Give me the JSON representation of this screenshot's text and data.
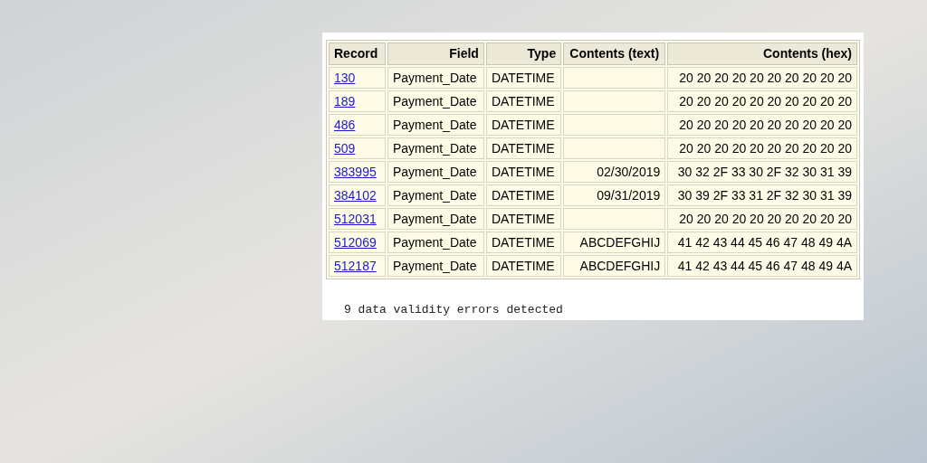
{
  "table": {
    "columns": [
      "Record",
      "Field",
      "Type",
      "Contents (text)",
      "Contents (hex)"
    ],
    "rows": [
      {
        "record": "130",
        "field": "Payment_Date",
        "type": "DATETIME",
        "contents_text": "",
        "contents_hex": "20 20 20 20 20 20 20 20 20 20"
      },
      {
        "record": "189",
        "field": "Payment_Date",
        "type": "DATETIME",
        "contents_text": "",
        "contents_hex": "20 20 20 20 20 20 20 20 20 20"
      },
      {
        "record": "486",
        "field": "Payment_Date",
        "type": "DATETIME",
        "contents_text": "",
        "contents_hex": "20 20 20 20 20 20 20 20 20 20"
      },
      {
        "record": "509",
        "field": "Payment_Date",
        "type": "DATETIME",
        "contents_text": "",
        "contents_hex": "20 20 20 20 20 20 20 20 20 20"
      },
      {
        "record": "383995",
        "field": "Payment_Date",
        "type": "DATETIME",
        "contents_text": "02/30/2019",
        "contents_hex": "30 32 2F 33 30 2F 32 30 31 39"
      },
      {
        "record": "384102",
        "field": "Payment_Date",
        "type": "DATETIME",
        "contents_text": "09/31/2019",
        "contents_hex": "30 39 2F 33 31 2F 32 30 31 39"
      },
      {
        "record": "512031",
        "field": "Payment_Date",
        "type": "DATETIME",
        "contents_text": "",
        "contents_hex": "20 20 20 20 20 20 20 20 20 20"
      },
      {
        "record": "512069",
        "field": "Payment_Date",
        "type": "DATETIME",
        "contents_text": "ABCDEFGHIJ",
        "contents_hex": "41 42 43 44 45 46 47 48 49 4A"
      },
      {
        "record": "512187",
        "field": "Payment_Date",
        "type": "DATETIME",
        "contents_text": "ABCDEFGHIJ",
        "contents_hex": "41 42 43 44 45 46 47 48 49 4A"
      }
    ]
  },
  "summary": "9 data validity errors detected"
}
